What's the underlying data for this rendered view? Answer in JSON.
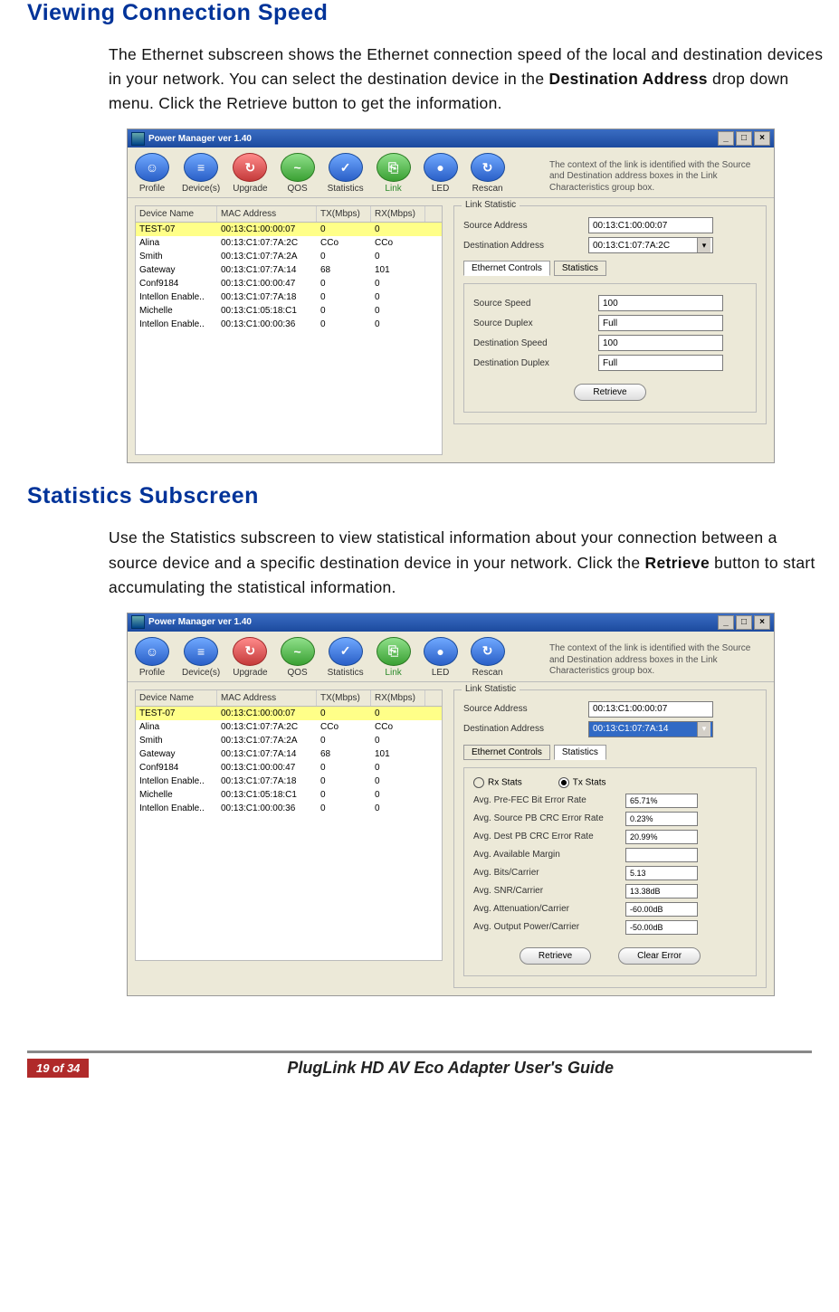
{
  "headings": {
    "h1": "Viewing Connection Speed",
    "h2": "Statistics Subscreen"
  },
  "para1": {
    "t1": "The Ethernet subscreen shows the Ethernet connection speed of the local and destination devices in your network. You can select the destination device in the ",
    "b1": "Destination Address",
    "t2": " drop down menu. Click the Retrieve button to get the information."
  },
  "para2": {
    "t1": "Use the Statistics subscreen to view statistical information about your connection between a source device and a specific destination device in your network. Click the ",
    "b1": "Retrieve",
    "t2": " button to start accumulating the statistical information."
  },
  "window": {
    "title": "Power Manager ver 1.40"
  },
  "winbtn": {
    "min": "_",
    "max": "□",
    "close": "×"
  },
  "toolbar": {
    "profile": "Profile",
    "devices": "Device(s)",
    "upgrade": "Upgrade",
    "qos": "QOS",
    "stats": "Statistics",
    "link": "Link",
    "led": "LED",
    "rescan": "Rescan",
    "glyph": {
      "profile": "☺",
      "devices": "≡",
      "upgrade": "↻",
      "qos": "~",
      "stats": "✓",
      "link": "⎘",
      "led": "●",
      "rescan": "↻"
    }
  },
  "caption1": "The context of the link is identified with the Source and Destination address boxes in the Link Characteristics group box.",
  "caption2": "The context of the link is identified with the Source and Destination address boxes in the Link Characteristics group box.",
  "cols": {
    "name": "Device Name",
    "mac": "MAC Address",
    "tx": "TX(Mbps)",
    "rx": "RX(Mbps)"
  },
  "devices": [
    {
      "name": "TEST-07",
      "mac": "00:13:C1:00:00:07",
      "tx": "0",
      "rx": "0"
    },
    {
      "name": "Alina",
      "mac": "00:13:C1:07:7A:2C",
      "tx": "CCo",
      "rx": "CCo"
    },
    {
      "name": "Smith",
      "mac": "00:13:C1:07:7A:2A",
      "tx": "0",
      "rx": "0"
    },
    {
      "name": "Gateway",
      "mac": "00:13:C1:07:7A:14",
      "tx": "68",
      "rx": "101"
    },
    {
      "name": "Conf9184",
      "mac": "00:13:C1:00:00:47",
      "tx": "0",
      "rx": "0"
    },
    {
      "name": "Intellon Enable..",
      "mac": "00:13:C1:07:7A:18",
      "tx": "0",
      "rx": "0"
    },
    {
      "name": "Michelle",
      "mac": "00:13:C1:05:18:C1",
      "tx": "0",
      "rx": "0"
    },
    {
      "name": "Intellon Enable..",
      "mac": "00:13:C1:00:00:36",
      "tx": "0",
      "rx": "0"
    }
  ],
  "link": {
    "group": "Link Statistic",
    "src_lbl": "Source Address",
    "src_val": "00:13:C1:00:00:07",
    "dst_lbl": "Destination Address",
    "dst_val": "00:13:C1:07:7A:2C",
    "tab_eth": "Ethernet Controls",
    "tab_stats": "Statistics",
    "retrieve": "Retrieve"
  },
  "eth": {
    "ssp_lbl": "Source Speed",
    "ssp": "100",
    "sdx_lbl": "Source Duplex",
    "sdx": "Full",
    "dsp_lbl": "Destination Speed",
    "dsp": "100",
    "ddx_lbl": "Destination Duplex",
    "ddx": "Full"
  },
  "stats2": {
    "dst_val": "00:13:C1:07:7A:14",
    "rx": "Rx Stats",
    "tx": "Tx Stats",
    "r0_lbl": "Avg. Pre-FEC Bit Error Rate",
    "r0": "65.71%",
    "r1_lbl": "Avg. Source PB CRC Error Rate",
    "r1": "0.23%",
    "r2_lbl": "Avg. Dest PB CRC Error Rate",
    "r2": "20.99%",
    "r3_lbl": "Avg. Available Margin",
    "r3": "",
    "r4_lbl": "Avg. Bits/Carrier",
    "r4": "5.13",
    "r5_lbl": "Avg. SNR/Carrier",
    "r5": "13.38dB",
    "r6_lbl": "Avg. Attenuation/Carrier",
    "r6": "-60.00dB",
    "r7_lbl": "Avg. Output Power/Carrier",
    "r7": "-50.00dB",
    "clear": "Clear Error"
  },
  "footer": {
    "page": "19 of 34",
    "title": "PlugLink HD AV Eco Adapter User's Guide"
  }
}
